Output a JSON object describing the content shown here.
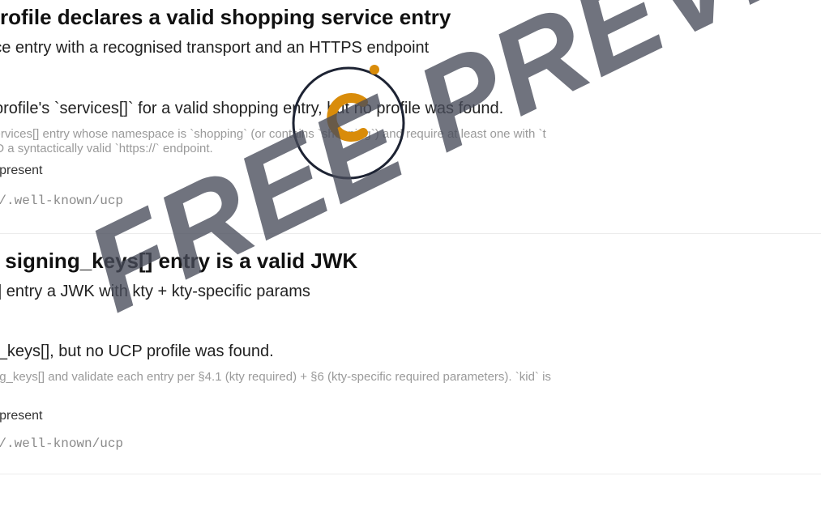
{
  "checks": [
    {
      "title": "P profile declares a valid shopping service entry",
      "subtitle": "ervice entry with a recognised transport and an HTTPS endpoint",
      "finding": "CP profile's `services[]` for a valid shopping entry, but no profile was found.",
      "hint": "ery services[] entry whose namespace is `shopping` (or contains `shopping`) and require at least one with `t\n}} AND a syntactically valid `https://` endpoint.",
      "status": "rofile present",
      "url": ".com/.well-known/ucp"
    },
    {
      "title": "ery signing_keys[] entry is a valid JWK",
      "subtitle": "eys[] entry a JWK with kty + kty-specific params",
      "finding": "ning_keys[], but no UCP profile was found.",
      "hint": "signing_keys[] and validate each entry per §4.1 (kty required) + §6 (kty-specific required parameters). `kid` is\nere.",
      "status": "rofile present",
      "url": ".com/.well-known/ucp"
    }
  ],
  "watermark": {
    "text": "FREE PREVIEW",
    "color": "#4a4e5c",
    "logo_letter": "C",
    "logo_accent": "#d98c0a",
    "logo_ring": "#1d2333"
  }
}
